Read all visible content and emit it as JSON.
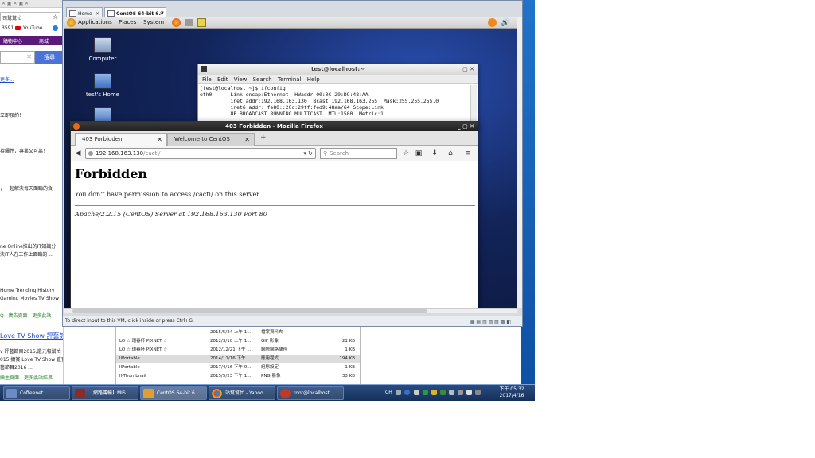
{
  "bg_page": {
    "address_text": "司幫幫忙",
    "bookmarks": [
      "3591",
      "YouTube"
    ],
    "nav_items": [
      "購物中心",
      "商城"
    ],
    "search_button": "搜尋",
    "more_link": "更多...",
    "lines": [
      "立即預約！",
      "持續性，專業又可靠！",
      "，一起解決每天面臨的負",
      "ne Online推出的IT知識分",
      "決IT人在工作上面臨的 ...",
      "Home  Trending  History",
      "Gaming  Movies  TV Show",
      "Q · 廣告頁面 - 更多此站"
    ],
    "love_link": "Love TV Show 評藝節目",
    "love_lines": [
      "v 評藝節目2015,還元報幫忙",
      "015 擴賞 Love TV Show 直實",
      "藝節目2016 ...",
      "續生頁面 - 更多此站結果"
    ]
  },
  "filelist": {
    "rows": [
      {
        "name": "",
        "date": "2015/5/24 上午 1...",
        "type": "檔案資料夾",
        "size": ""
      },
      {
        "name": "LO ☆ 環春杯 PIXNET ☆",
        "date": "2012/3/10 上午 1...",
        "type": "GIF 影像",
        "size": "21 KB"
      },
      {
        "name": "LO ☆ 環春杯 PIXNET ☆",
        "date": "2012/12/21 下午 ...",
        "type": "網際網路捷徑",
        "size": "1 KB"
      },
      {
        "name": "llPortable",
        "date": "2014/11/16 下午 ...",
        "type": "應用程式",
        "size": "194 KB"
      },
      {
        "name": "llPortable",
        "date": "2017/4/16 下午 0...",
        "type": "組態設定",
        "size": "1 KB"
      },
      {
        "name": "ll-Thumbnail",
        "date": "2015/5/23 下午 1...",
        "type": "PNG 影像",
        "size": "33 KB"
      }
    ]
  },
  "vmware": {
    "tabs": [
      {
        "label": "Home"
      },
      {
        "label": "CentOS 64-bit 6.7"
      }
    ],
    "status_text": "To direct input to this VM, click inside or press Ctrl+G."
  },
  "guest": {
    "panel_menus": [
      "Applications",
      "Places",
      "System"
    ],
    "desktop_icons": [
      "Computer",
      "test's Home"
    ],
    "terminal": {
      "title": "test@localhost:~",
      "menus": [
        "File",
        "Edit",
        "View",
        "Search",
        "Terminal",
        "Help"
      ],
      "lines": [
        "[test@localhost ~]$ ifconfig",
        "eth0      Link encap:Ethernet  HWaddr 00:0C:29:D9:48:AA",
        "          inet addr:192.168.163.130  Bcast:192.168.163.255  Mask:255.255.255.0",
        "          inet6 addr: fe80::20c:29ff:fed9:48aa/64 Scope:Link",
        "          UP BROADCAST RUNNING MULTICAST  MTU:1500  Metric:1"
      ]
    },
    "firefox": {
      "title": "403 Forbidden - Mozilla Firefox",
      "tabs": [
        {
          "label": "403 Forbidden"
        },
        {
          "label": "Welcome to CentOS"
        }
      ],
      "url_host": "192.168.163.130",
      "url_path": "/cacti/",
      "search_placeholder": "Search",
      "heading": "Forbidden",
      "message": "You don't have permission to access /cacti/ on this server.",
      "address": "Apache/2.2.15 (CentOS) Server at 192.168.163.130 Port 80"
    }
  },
  "taskbar": {
    "buttons": [
      "Coffeenet",
      "【網路傳輸】MIS...",
      "CentOS 64-bit 6....",
      "站幫幫忙 - Yahoo...",
      "root@localhost..."
    ],
    "clock_time": "下午 05:32",
    "clock_date": "2017/4/16",
    "ime": "CH"
  },
  "colors": {
    "taskbar": "#14305c",
    "guest_desktop": "#12245a",
    "link": "#1a4bd6"
  }
}
